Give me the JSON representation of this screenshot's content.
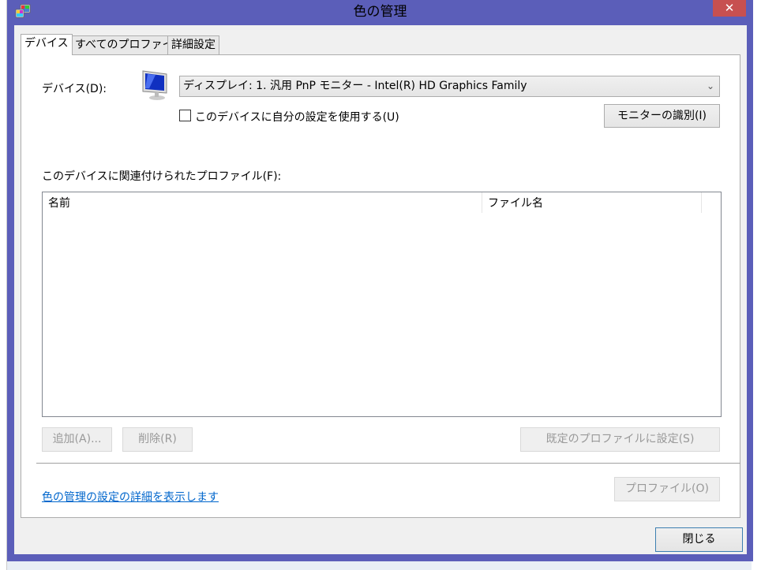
{
  "window": {
    "title": "色の管理",
    "close_icon": "close-icon"
  },
  "tabs": [
    {
      "label": "デバイス"
    },
    {
      "label": "すべてのプロファイル"
    },
    {
      "label": "詳細設定"
    }
  ],
  "device": {
    "label": "デバイス(D):",
    "selected": "ディスプレイ: 1. 汎用 PnP モニター - Intel(R) HD Graphics Family",
    "use_my_settings_label": "このデバイスに自分の設定を使用する(U)",
    "use_my_settings_checked": false,
    "identify_button": "モニターの識別(I)"
  },
  "profiles": {
    "label": "このデバイスに関連付けられたプロファイル(F):",
    "columns": [
      "名前",
      "ファイル名"
    ],
    "rows": []
  },
  "buttons": {
    "add": "追加(A)...",
    "remove": "削除(R)",
    "set_default": "既定のプロファイルに設定(S)",
    "profile": "プロファイル(O)",
    "close": "閉じる"
  },
  "link": "色の管理の設定の詳細を表示します"
}
